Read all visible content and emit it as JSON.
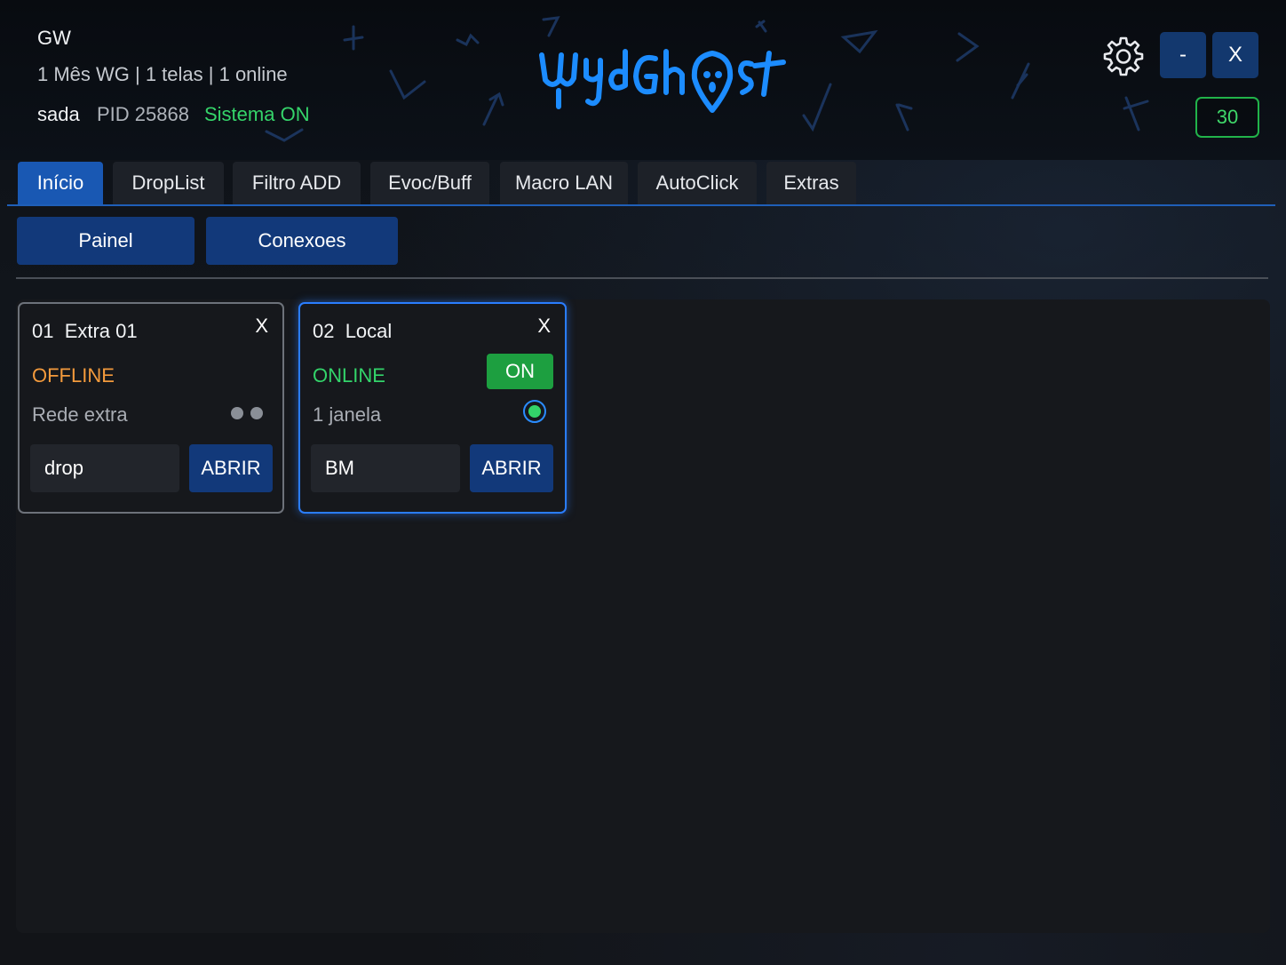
{
  "header": {
    "title": "GW",
    "subtitle": "1 Mês WG | 1 telas | 1 online",
    "user": "sada",
    "pid": "PID 25868",
    "system_status": "Sistema ON",
    "logo_text": "WydGhost",
    "minimize_label": "-",
    "close_label": "X",
    "counter": "30"
  },
  "tabs": [
    {
      "label": "Início",
      "active": true
    },
    {
      "label": "DropList"
    },
    {
      "label": "Filtro ADD"
    },
    {
      "label": "Evoc/Buff"
    },
    {
      "label": "Macro LAN"
    },
    {
      "label": "AutoClick"
    },
    {
      "label": "Extras"
    }
  ],
  "subtabs": [
    {
      "label": "Painel"
    },
    {
      "label": "Conexoes"
    }
  ],
  "cards": [
    {
      "title": "01  Extra 01",
      "status": "OFFLINE",
      "status_color": "#f39a3c",
      "note": "Rede extra",
      "input_value": "drop",
      "open_label": "ABRIR",
      "close_label": "X"
    },
    {
      "title": "02  Local",
      "status": "ONLINE",
      "status_color": "#33d46a",
      "note": "1 janela",
      "toggle_label": "ON",
      "input_value": "BM",
      "open_label": "ABRIR",
      "close_label": "X"
    }
  ],
  "colors": {
    "accent": "#1958b3",
    "button": "#12397a",
    "online": "#33d46a",
    "offline": "#f39a3c"
  }
}
